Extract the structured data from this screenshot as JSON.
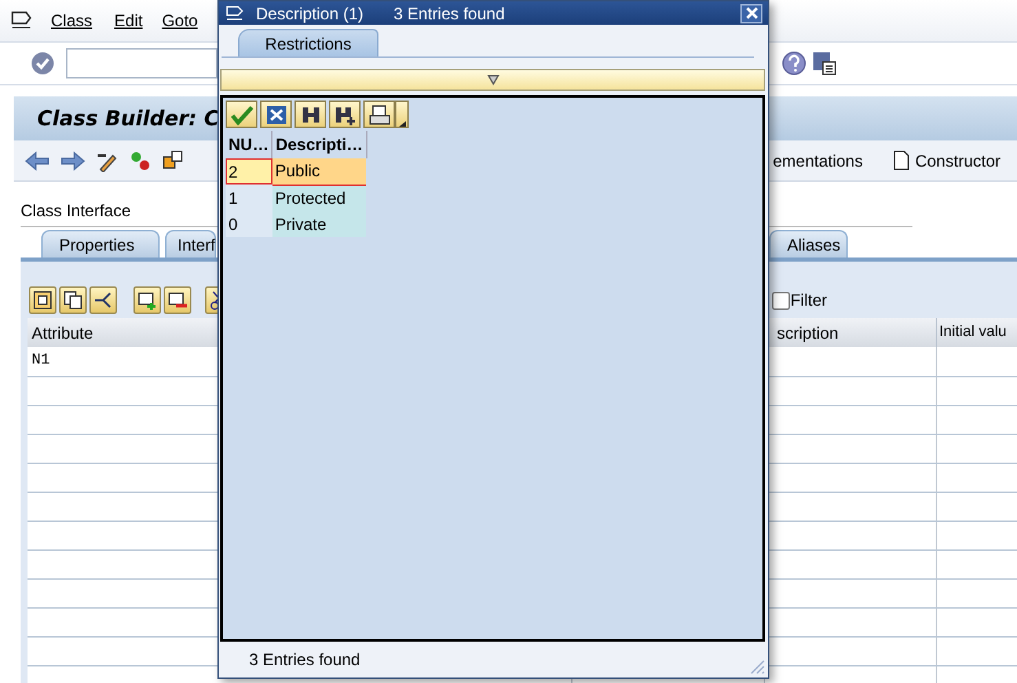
{
  "menu_bar": {
    "items": [
      "Class",
      "Edit",
      "Goto"
    ]
  },
  "title": "Class Builder: C",
  "app_toolbar": {
    "buttons": [
      "ementations",
      "Constructor"
    ]
  },
  "section_title": "Class Interface",
  "tabs": [
    {
      "label": "Properties",
      "selected": false
    },
    {
      "label": "Interf",
      "selected": false
    },
    {
      "label": "Aliases",
      "selected": false
    }
  ],
  "filter": {
    "label": "Filter",
    "checked": false
  },
  "table": {
    "columns": [
      "Attribute",
      "scription",
      "Initial valu"
    ],
    "rows": [
      {
        "attribute": "N1"
      }
    ]
  },
  "dialog": {
    "title": "Description (1)",
    "subtitle": "3 Entries found",
    "tab": {
      "label": "Restrictions",
      "selected": true
    },
    "columns": [
      "NU…",
      "Descripti…"
    ],
    "rows": [
      {
        "key": "2",
        "text": "Public",
        "selected": true
      },
      {
        "key": "1",
        "text": "Protected",
        "selected": false
      },
      {
        "key": "0",
        "text": "Private",
        "selected": false
      }
    ],
    "status": "3 Entries found"
  }
}
